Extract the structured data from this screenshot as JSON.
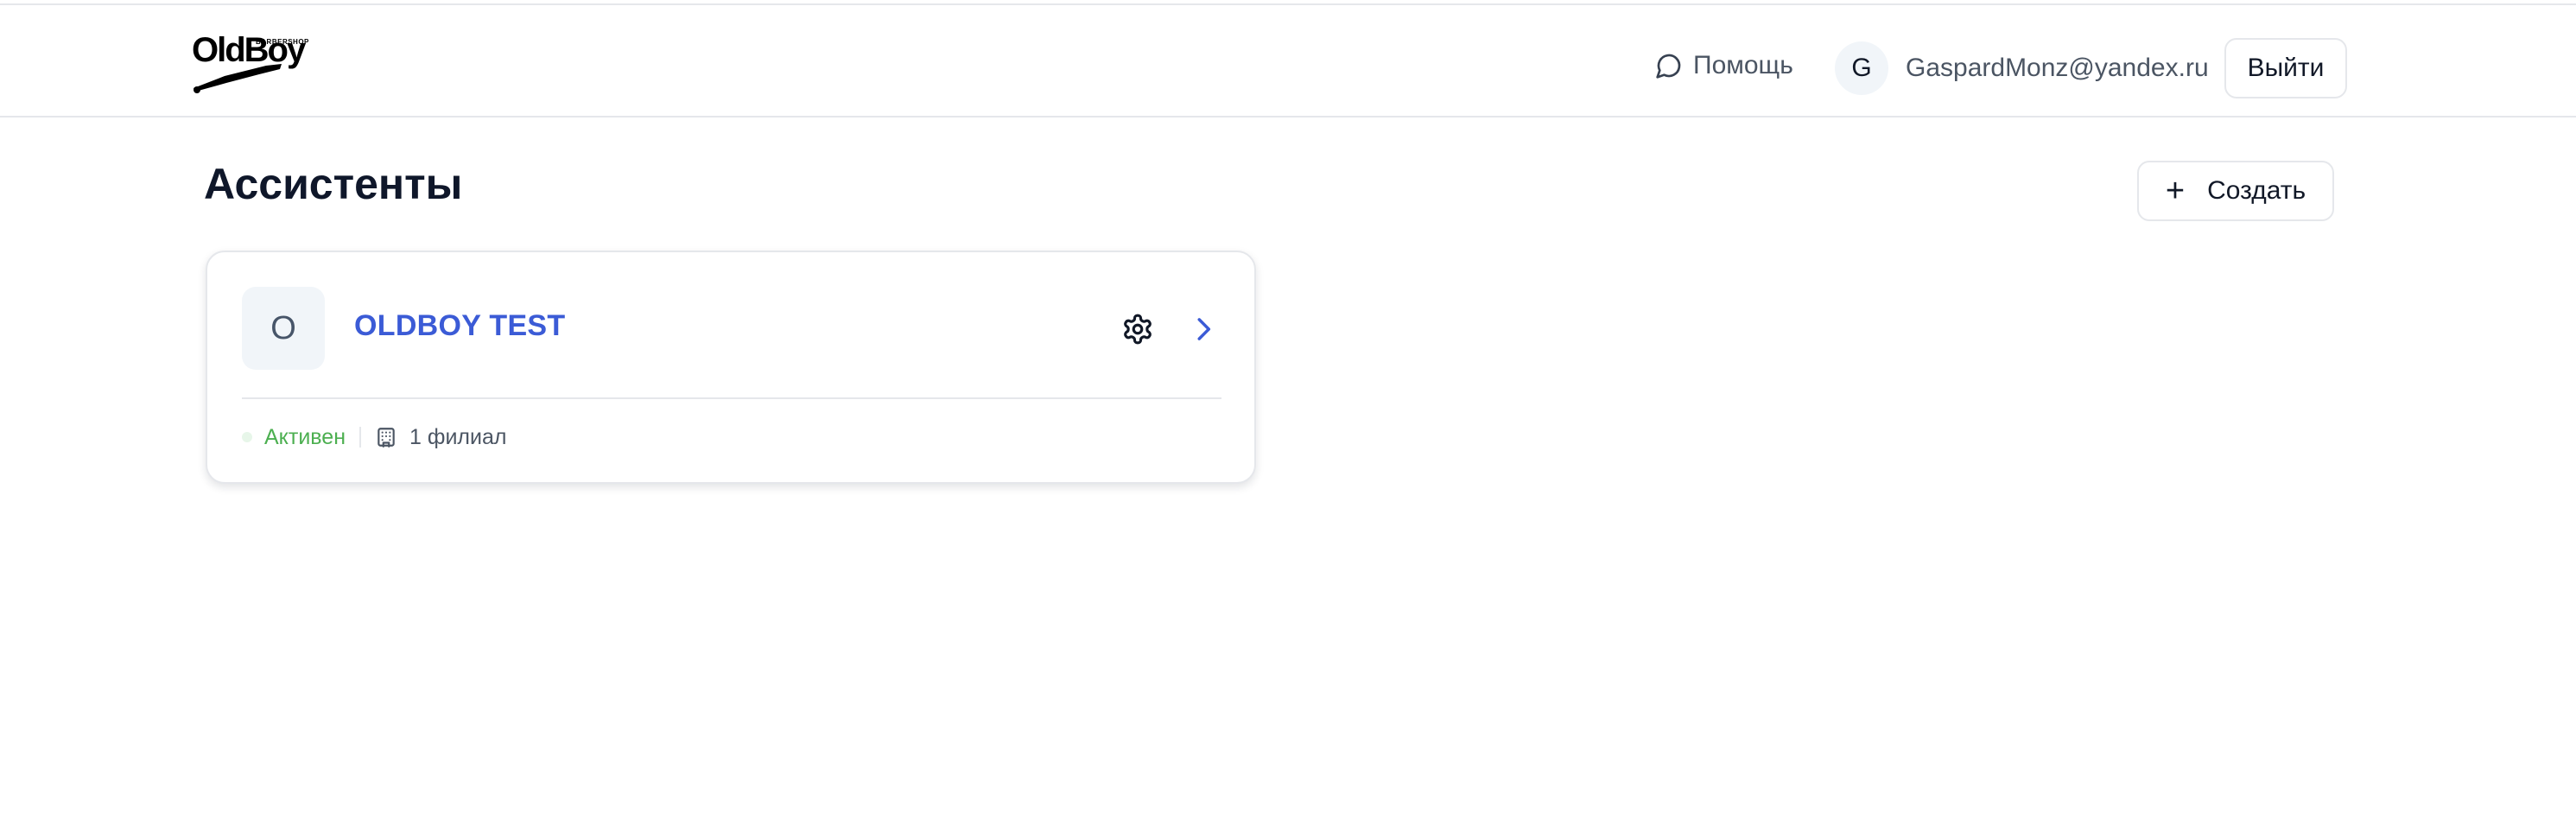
{
  "header": {
    "logo": {
      "text": "OldBoy",
      "subtext": "BARBERSHOP"
    },
    "help": {
      "label": "Помощь",
      "icon": "chat-bubble-icon"
    },
    "user": {
      "initial": "G",
      "email": "GaspardMonz@yandex.ru"
    },
    "logout_label": "Выйти"
  },
  "page": {
    "title": "Ассистенты",
    "create_label": "Создать",
    "create_icon": "plus-icon"
  },
  "assistants": [
    {
      "initial": "O",
      "name": "OLDBOY TEST",
      "status": "Активен",
      "branches": "1 филиал"
    }
  ],
  "colors": {
    "accent": "#3b5bd6",
    "status_active": "#4caf50",
    "border": "#e5e7eb",
    "avatar_bg": "#f1f5f9"
  }
}
